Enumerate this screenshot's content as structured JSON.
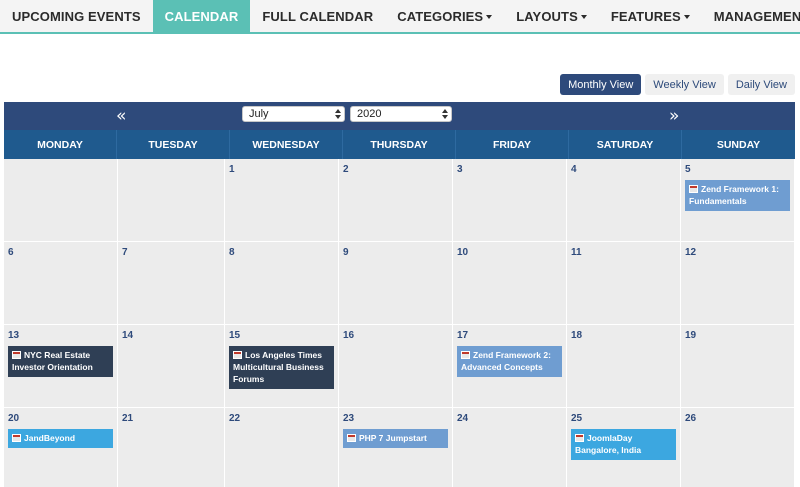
{
  "nav": {
    "items": [
      {
        "label": "UPCOMING EVENTS",
        "dropdown": false,
        "active": false
      },
      {
        "label": "CALENDAR",
        "dropdown": false,
        "active": true
      },
      {
        "label": "FULL CALENDAR",
        "dropdown": false,
        "active": false
      },
      {
        "label": "CATEGORIES",
        "dropdown": true,
        "active": false
      },
      {
        "label": "LAYOUTS",
        "dropdown": true,
        "active": false
      },
      {
        "label": "FEATURES",
        "dropdown": true,
        "active": false
      },
      {
        "label": "MANAGEMENT",
        "dropdown": true,
        "active": false
      }
    ]
  },
  "views": {
    "monthly": "Monthly View",
    "weekly": "Weekly View",
    "daily": "Daily View",
    "active": "monthly"
  },
  "calendar": {
    "prev_label": "«",
    "next_label": "»",
    "month": "July",
    "year": "2020",
    "days": [
      "MONDAY",
      "TUESDAY",
      "WEDNESDAY",
      "THURSDAY",
      "FRIDAY",
      "SATURDAY",
      "SUNDAY"
    ],
    "weeks": [
      [
        {
          "day": "",
          "events": []
        },
        {
          "day": "",
          "events": []
        },
        {
          "day": "1",
          "events": []
        },
        {
          "day": "2",
          "events": []
        },
        {
          "day": "3",
          "events": []
        },
        {
          "day": "4",
          "events": []
        },
        {
          "day": "5",
          "events": [
            {
              "title": "Zend Framework 1: Fundamentals",
              "style": "light"
            }
          ]
        }
      ],
      [
        {
          "day": "6",
          "events": []
        },
        {
          "day": "7",
          "events": []
        },
        {
          "day": "8",
          "events": []
        },
        {
          "day": "9",
          "events": []
        },
        {
          "day": "10",
          "events": []
        },
        {
          "day": "11",
          "events": []
        },
        {
          "day": "12",
          "events": []
        }
      ],
      [
        {
          "day": "13",
          "events": [
            {
              "title": "NYC Real Estate Investor Orientation",
              "style": "dark"
            }
          ]
        },
        {
          "day": "14",
          "events": []
        },
        {
          "day": "15",
          "events": [
            {
              "title": "Los Angeles Times Multicultural Business Forums",
              "style": "dark"
            }
          ]
        },
        {
          "day": "16",
          "events": []
        },
        {
          "day": "17",
          "events": [
            {
              "title": "Zend Framework 2: Advanced Concepts",
              "style": "light"
            }
          ]
        },
        {
          "day": "18",
          "events": []
        },
        {
          "day": "19",
          "events": []
        }
      ],
      [
        {
          "day": "20",
          "events": [
            {
              "title": "JandBeyond",
              "style": "cyan"
            }
          ]
        },
        {
          "day": "21",
          "events": []
        },
        {
          "day": "22",
          "events": []
        },
        {
          "day": "23",
          "events": [
            {
              "title": "PHP 7 Jumpstart",
              "style": "light"
            }
          ]
        },
        {
          "day": "24",
          "events": []
        },
        {
          "day": "25",
          "events": [
            {
              "title": "JoomlaDay Bangalore, India",
              "style": "cyan"
            }
          ]
        },
        {
          "day": "26",
          "events": []
        }
      ]
    ]
  },
  "colors": {
    "nav_active": "#5bc0b5",
    "header_blue": "#2e4a7b",
    "dayrow_blue": "#1f5a8e",
    "event_light": "#6f9dd1",
    "event_dark": "#2f3f55",
    "event_cyan": "#3ca7e0"
  },
  "icons": {
    "event": "calendar-event-icon",
    "dropdown": "caret-down-icon"
  }
}
